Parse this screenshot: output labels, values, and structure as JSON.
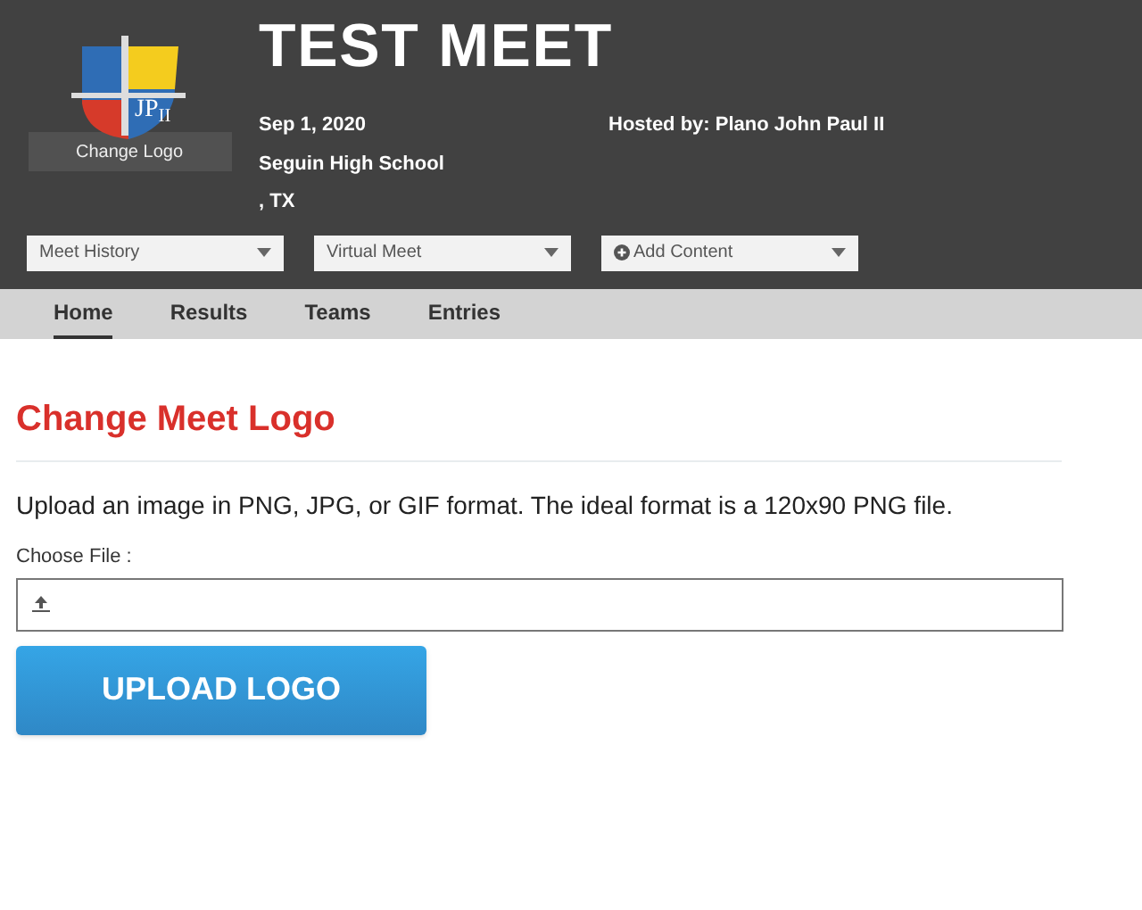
{
  "header": {
    "logo_text": "JP$_{II}$",
    "change_logo": "Change Logo",
    "title": "TEST MEET",
    "date": "Sep 1, 2020",
    "venue": "Seguin High School",
    "location": ", TX",
    "host": "Hosted by: Plano John Paul II"
  },
  "dropdowns": [
    {
      "label": "Meet History",
      "kind": "plain"
    },
    {
      "label": "Virtual Meet",
      "kind": "plain"
    },
    {
      "label": "Add Content",
      "kind": "add"
    }
  ],
  "tabs": [
    {
      "label": "Home",
      "selected": true
    },
    {
      "label": "Results",
      "selected": false
    },
    {
      "label": "Teams",
      "selected": false
    },
    {
      "label": "Entries",
      "selected": false
    }
  ],
  "content": {
    "heading": "Change Meet Logo",
    "description": "Upload an image in PNG, JPG, or GIF format. The ideal format is a 120x90 PNG file.",
    "file_label": "Choose File :",
    "upload_button": "UPLOAD LOGO"
  }
}
